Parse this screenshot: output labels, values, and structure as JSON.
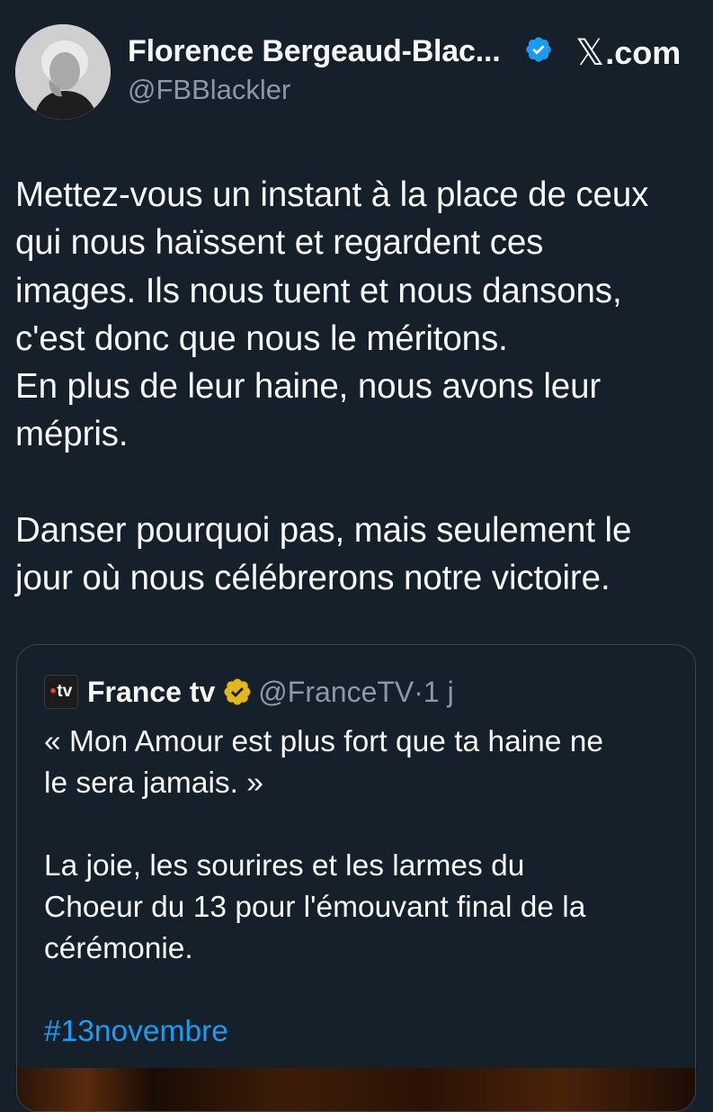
{
  "author": {
    "name": "Florence Bergeaud-Blac...",
    "handle": "@FBBlackler"
  },
  "site": {
    "logo_icon": "x-logo-icon",
    "label": ".com"
  },
  "tweet": {
    "text": "Mettez-vous un instant à la place de ceux\nqui nous haïssent et regardent ces\nimages. Ils nous tuent et nous dansons,\nc'est donc que nous le méritons.\nEn plus de leur haine, nous avons leur\nmépris.\n\nDanser pourquoi pas, mais seulement le\njour où nous célébrerons notre victoire."
  },
  "quote": {
    "logo_text": "tv",
    "name": "France tv",
    "handle_time": "@FranceTV·1 j",
    "text": "« Mon Amour est plus fort que ta haine ne\nle sera jamais. »\n\nLa joie, les sourires et les larmes du\nChoeur du 13 pour l'émouvant final de la\ncérémonie.\n\n",
    "hashtag": "#13novembre"
  },
  "colors": {
    "background": "#15202b",
    "text": "#f7f9f9",
    "secondary": "#8b98a5",
    "accent": "#1d9bf0",
    "gold_badge": "#e2b719",
    "border": "#38444d"
  }
}
